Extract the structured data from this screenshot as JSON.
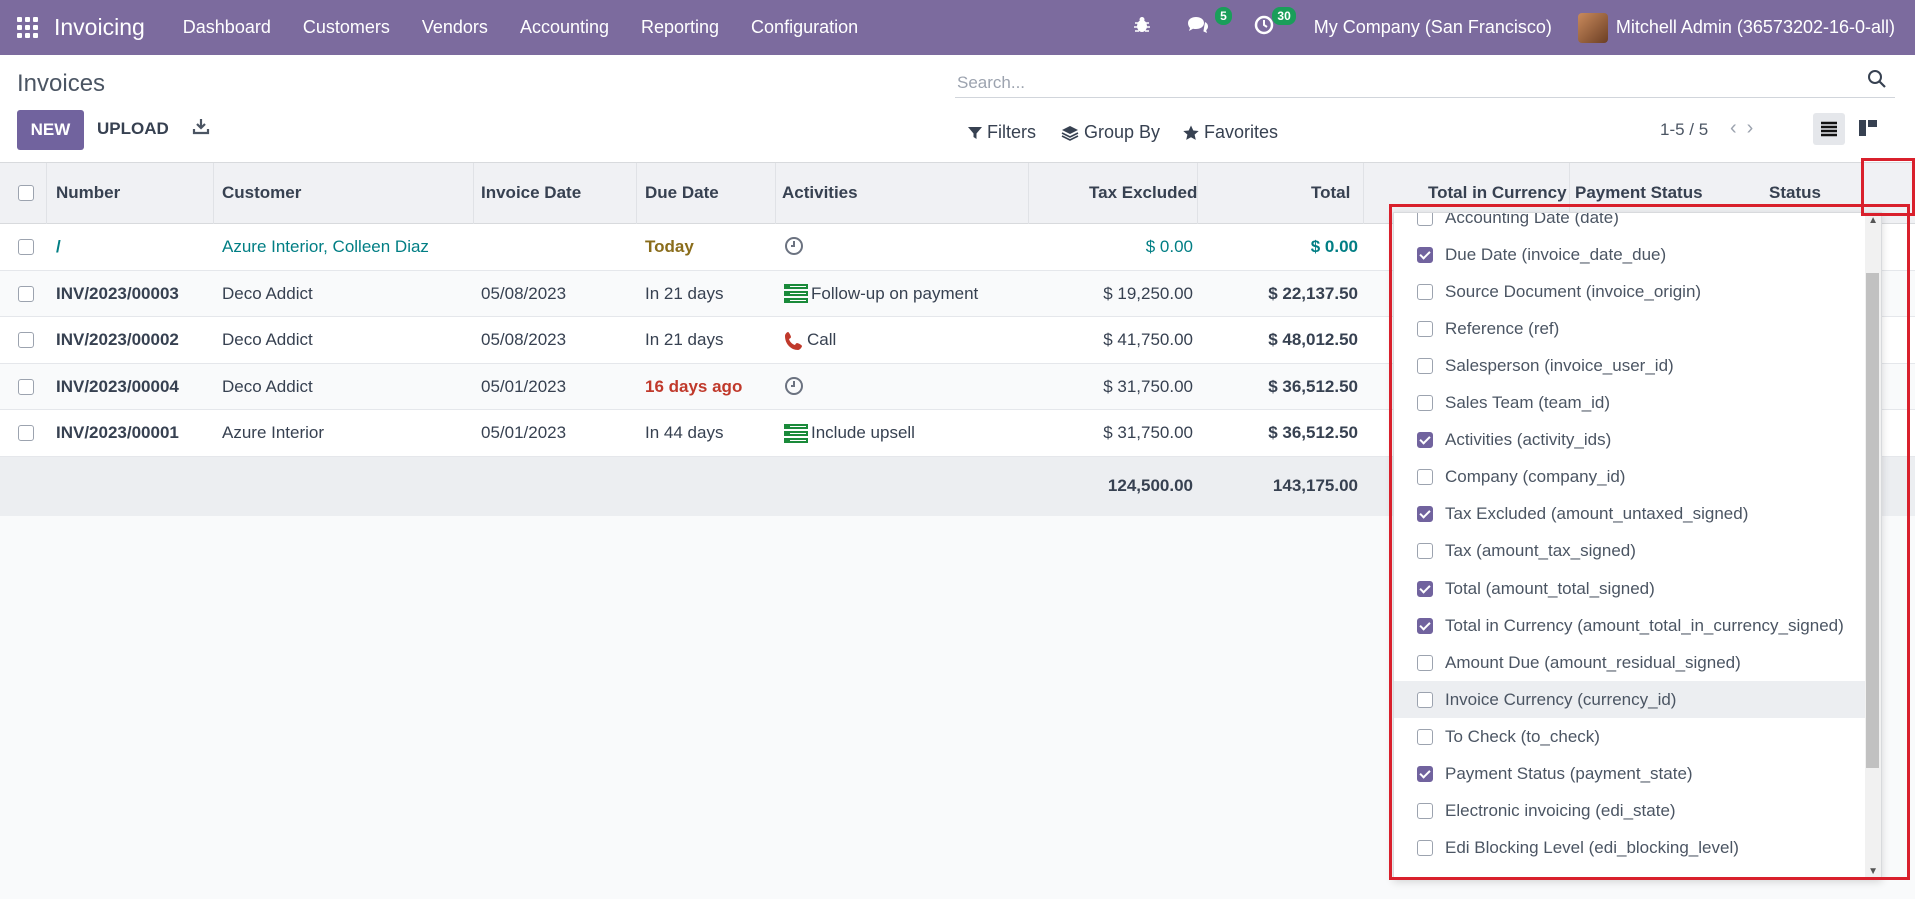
{
  "topbar": {
    "app_name": "Invoicing",
    "menu": [
      "Dashboard",
      "Customers",
      "Vendors",
      "Accounting",
      "Reporting",
      "Configuration"
    ],
    "messages_count": "5",
    "activities_count": "30",
    "company": "My Company (San Francisco)",
    "user": "Mitchell Admin (36573202-16-0-all)"
  },
  "control_panel": {
    "title": "Invoices",
    "new_label": "NEW",
    "upload_label": "UPLOAD",
    "search_placeholder": "Search...",
    "filters_label": "Filters",
    "group_by_label": "Group By",
    "favorites_label": "Favorites",
    "pager": "1-5 / 5"
  },
  "table": {
    "headers": {
      "number": "Number",
      "customer": "Customer",
      "invoice_date": "Invoice Date",
      "due_date": "Due Date",
      "activities": "Activities",
      "tax_excluded": "Tax Excluded",
      "total": "Total",
      "total_currency": "Total in Currency",
      "payment_status": "Payment Status",
      "status": "Status"
    },
    "rows": [
      {
        "number": "/",
        "customer": "Azure Interior, Colleen Diaz",
        "invoice_date": "",
        "due_date": "Today",
        "activity": "",
        "tax_excluded": "$ 0.00",
        "total": "$ 0.00"
      },
      {
        "number": "INV/2023/00003",
        "customer": "Deco Addict",
        "invoice_date": "05/08/2023",
        "due_date": "In 21 days",
        "activity": "Follow-up on payment",
        "tax_excluded": "$ 19,250.00",
        "total": "$ 22,137.50"
      },
      {
        "number": "INV/2023/00002",
        "customer": "Deco Addict",
        "invoice_date": "05/08/2023",
        "due_date": "In 21 days",
        "activity": "Call",
        "tax_excluded": "$ 41,750.00",
        "total": "$ 48,012.50"
      },
      {
        "number": "INV/2023/00004",
        "customer": "Deco Addict",
        "invoice_date": "05/01/2023",
        "due_date": "16 days ago",
        "activity": "",
        "tax_excluded": "$ 31,750.00",
        "total": "$ 36,512.50"
      },
      {
        "number": "INV/2023/00001",
        "customer": "Azure Interior",
        "invoice_date": "05/01/2023",
        "due_date": "In 44 days",
        "activity": "Include upsell",
        "tax_excluded": "$ 31,750.00",
        "total": "$ 36,512.50"
      }
    ],
    "totals": {
      "tax_excluded": "124,500.00",
      "total": "143,175.00"
    }
  },
  "optional_columns": [
    {
      "label": "Accounting Date (date)",
      "checked": false
    },
    {
      "label": "Due Date (invoice_date_due)",
      "checked": true
    },
    {
      "label": "Source Document (invoice_origin)",
      "checked": false
    },
    {
      "label": "Reference (ref)",
      "checked": false
    },
    {
      "label": "Salesperson (invoice_user_id)",
      "checked": false
    },
    {
      "label": "Sales Team (team_id)",
      "checked": false
    },
    {
      "label": "Activities (activity_ids)",
      "checked": true
    },
    {
      "label": "Company (company_id)",
      "checked": false
    },
    {
      "label": "Tax Excluded (amount_untaxed_signed)",
      "checked": true
    },
    {
      "label": "Tax (amount_tax_signed)",
      "checked": false
    },
    {
      "label": "Total (amount_total_signed)",
      "checked": true
    },
    {
      "label": "Total in Currency (amount_total_in_currency_signed)",
      "checked": true
    },
    {
      "label": "Amount Due (amount_residual_signed)",
      "checked": false
    },
    {
      "label": "Invoice Currency (currency_id)",
      "checked": false
    },
    {
      "label": "To Check (to_check)",
      "checked": false
    },
    {
      "label": "Payment Status (payment_state)",
      "checked": true
    },
    {
      "label": "Electronic invoicing (edi_state)",
      "checked": false
    },
    {
      "label": "Edi Blocking Level (edi_blocking_level)",
      "checked": false
    }
  ],
  "colors": {
    "brand": "#7c6b9e",
    "primary": "#71639e",
    "link": "#017e84",
    "warning": "#8a6d1b",
    "danger": "#c0392b",
    "highlight": "#d9202c"
  }
}
